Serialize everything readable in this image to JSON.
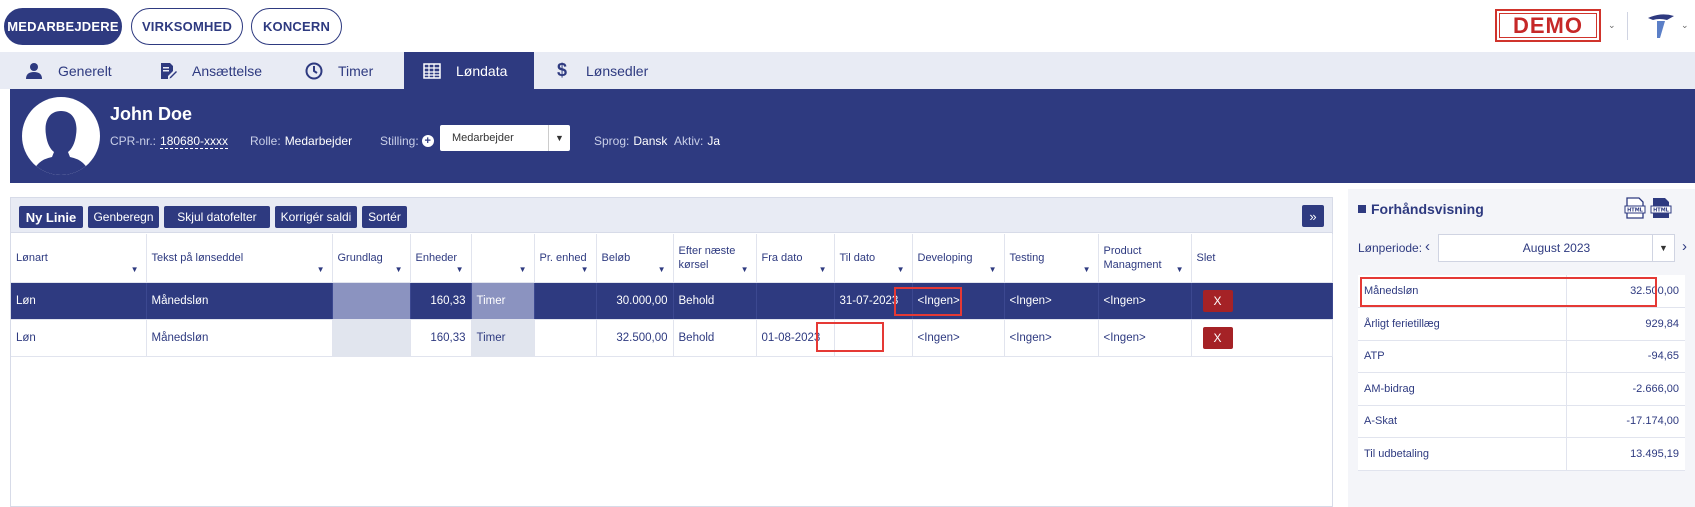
{
  "topnav": {
    "buttons": [
      "MEDARBEJDERE",
      "VIRKSOMHED",
      "KONCERN"
    ],
    "demo_label": "DEMO"
  },
  "tabs": [
    {
      "label": "Generelt",
      "icon": "user-icon"
    },
    {
      "label": "Ansættelse",
      "icon": "document-edit-icon"
    },
    {
      "label": "Timer",
      "icon": "clock-icon"
    },
    {
      "label": "Løndata",
      "icon": "table-icon",
      "active": true
    },
    {
      "label": "Lønsedler",
      "icon": "dollar-icon"
    }
  ],
  "employee": {
    "name": "John Doe",
    "cpr_label": "CPR-nr.:",
    "cpr_value": "180680-xxxx",
    "role_label": "Rolle:",
    "role_value": "Medarbejder",
    "position_label": "Stilling:",
    "position_value": "Medarbejder",
    "language_label": "Sprog:",
    "language_value": "Dansk",
    "active_label": "Aktiv:",
    "active_value": "Ja"
  },
  "toolbar": {
    "new_line": "Ny Linie",
    "recalc": "Genberegn",
    "hide_dates": "Skjul datofelter",
    "correct_balance": "Korrigér saldi",
    "sort": "Sortér",
    "expand": "»"
  },
  "grid": {
    "columns": [
      "Lønart",
      "Tekst på lønseddel",
      "Grundlag",
      "Enheder",
      "",
      "Pr. enhed",
      "Beløb",
      "Efter næste kørsel",
      "Fra dato",
      "Til dato",
      "Developing",
      "Testing",
      "Product Managment",
      "Slet"
    ],
    "rows": [
      {
        "lonart": "Løn",
        "tekst": "Månedsløn",
        "grundlag": "",
        "enheder": "160,33",
        "unit": "Timer",
        "pr_enhed": "",
        "belob": "30.000,00",
        "efter": "Behold",
        "fra": "",
        "til": "31-07-2023",
        "developing": "<Ingen>",
        "testing": "<Ingen>",
        "product": "<Ingen>",
        "slet": "X"
      },
      {
        "lonart": "Løn",
        "tekst": "Månedsløn",
        "grundlag": "",
        "enheder": "160,33",
        "unit": "Timer",
        "pr_enhed": "",
        "belob": "32.500,00",
        "efter": "Behold",
        "fra": "01-08-2023",
        "til": "",
        "developing": "<Ingen>",
        "testing": "<Ingen>",
        "product": "<Ingen>",
        "slet": "X"
      }
    ]
  },
  "preview": {
    "title": "Forhåndsvisning",
    "period_label": "Lønperiode:",
    "period_value": "August 2023",
    "rows": [
      {
        "label": "Månedsløn",
        "value": "32.500,00"
      },
      {
        "label": "Årligt ferietillæg",
        "value": "929,84"
      },
      {
        "label": "ATP",
        "value": "-94,65"
      },
      {
        "label": "AM-bidrag",
        "value": "-2.666,00"
      },
      {
        "label": "A-Skat",
        "value": "-17.174,00"
      },
      {
        "label": "Til udbetaling",
        "value": "13.495,19"
      }
    ]
  },
  "colors": {
    "primary": "#2e3a80",
    "danger": "#a52226",
    "highlight": "#e53935"
  }
}
